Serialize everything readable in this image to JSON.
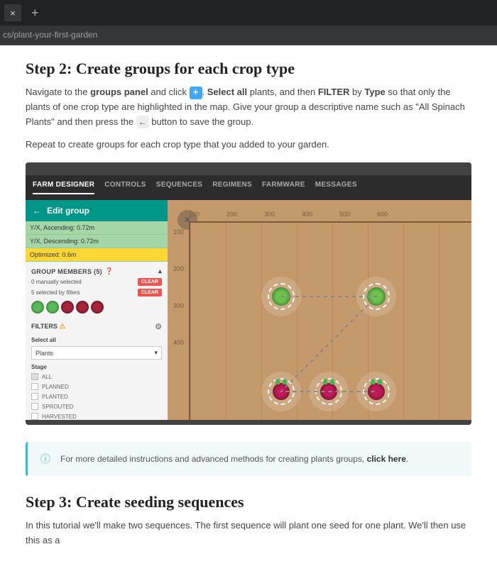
{
  "browser": {
    "url_fragment": "cs/plant-your-first-garden"
  },
  "doc": {
    "step2_title": "Step 2: Create groups for each crop type",
    "p1_a": "Navigate to the ",
    "p1_b": "groups panel",
    "p1_c": " and click ",
    "p1_d": ". ",
    "p1_e": "Select all",
    "p1_f": " plants, and then ",
    "p1_g": "FILTER",
    "p1_h": " by ",
    "p1_i": "Type",
    "p1_j": " so that only the plants of one crop type are highlighted in the map. Give your group a descriptive name such as \"All Spinach Plants\" and then press the ",
    "p1_k": " button to save the group.",
    "p2": "Repeat to create groups for each crop type that you added to your garden.",
    "banner_a": "For more detailed instructions and advanced methods for creating plants groups, ",
    "banner_link": "click here",
    "banner_b": ".",
    "step3_title": "Step 3: Create seeding sequences",
    "p3": "In this tutorial we'll make two sequences. The first sequence will plant one seed for one plant. We'll then use this as a"
  },
  "app": {
    "tabs": [
      "FARM DESIGNER",
      "CONTROLS",
      "SEQUENCES",
      "REGIMENS",
      "FARMWARE",
      "MESSAGES"
    ],
    "panel_title": "Edit group",
    "sort_rows": [
      "Y/X, Ascending: 0.72m",
      "Y/X, Descending: 0.72m"
    ],
    "sort_optimized": "Optimized: 0.6m",
    "members_title": "GROUP MEMBERS (5)",
    "manually_selected": "0 manually selected",
    "filter_selected": "5 selected by filters",
    "clear_label": "CLEAR",
    "filters_title": "FILTERS",
    "select_all_label": "Select all",
    "select_value": "Plants",
    "stage_label": "Stage",
    "stages": [
      "ALL",
      "PLANNED",
      "PLANTED",
      "SPROUTED",
      "HARVESTED"
    ],
    "xticks": [
      "100",
      "200",
      "300",
      "400",
      "500",
      "600"
    ],
    "yticks": [
      "100",
      "200",
      "300",
      "400"
    ]
  }
}
